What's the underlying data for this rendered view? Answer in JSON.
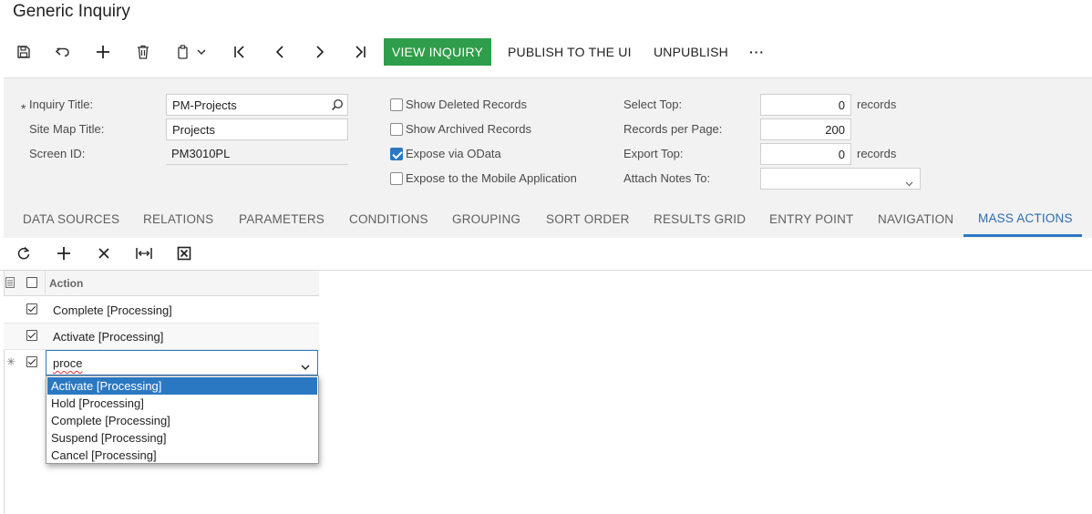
{
  "page": {
    "title": "Generic Inquiry"
  },
  "toolbar": {
    "view_inquiry_label": "VIEW INQUIRY",
    "publish_label": "PUBLISH TO THE UI",
    "unpublish_label": "UNPUBLISH",
    "more_label": "···"
  },
  "form": {
    "inquiry_title_label": "Inquiry Title:",
    "inquiry_title_required": "*",
    "inquiry_title_value": "PM-Projects",
    "site_map_title_label": "Site Map Title:",
    "site_map_title_value": "Projects",
    "screen_id_label": "Screen ID:",
    "screen_id_value": "PM3010PL",
    "show_deleted_label": "Show Deleted Records",
    "show_deleted_checked": false,
    "show_archived_label": "Show Archived Records",
    "show_archived_checked": false,
    "expose_odata_label": "Expose via OData",
    "expose_odata_checked": true,
    "expose_mobile_label": "Expose to the Mobile Application",
    "expose_mobile_checked": false,
    "select_top_label": "Select Top:",
    "select_top_value": "0",
    "select_top_unit": "records",
    "records_per_page_label": "Records per Page:",
    "records_per_page_value": "200",
    "export_top_label": "Export Top:",
    "export_top_value": "0",
    "export_top_unit": "records",
    "attach_notes_label": "Attach Notes To:",
    "attach_notes_value": ""
  },
  "tabs": [
    {
      "label": "DATA SOURCES",
      "active": false
    },
    {
      "label": "RELATIONS",
      "active": false
    },
    {
      "label": "PARAMETERS",
      "active": false
    },
    {
      "label": "CONDITIONS",
      "active": false
    },
    {
      "label": "GROUPING",
      "active": false
    },
    {
      "label": "SORT ORDER",
      "active": false
    },
    {
      "label": "RESULTS GRID",
      "active": false
    },
    {
      "label": "ENTRY POINT",
      "active": false
    },
    {
      "label": "NAVIGATION",
      "active": false
    },
    {
      "label": "MASS ACTIONS",
      "active": true
    }
  ],
  "grid": {
    "header_action": "Action",
    "rows": [
      {
        "checked": true,
        "action": "Complete [Processing]"
      },
      {
        "checked": true,
        "action": "Activate [Processing]"
      }
    ],
    "new_row": {
      "checked": true,
      "marker": "✳",
      "edit_value": "proce"
    }
  },
  "dropdown": {
    "options": [
      "Activate [Processing]",
      "Hold [Processing]",
      "Complete [Processing]",
      "Suspend [Processing]",
      "Cancel [Processing]"
    ],
    "selected_index": 0
  },
  "colors": {
    "accent": "#2b78c2",
    "view_inquiry_bg": "#2e9e4a",
    "form_bg": "#f2f2f2"
  }
}
